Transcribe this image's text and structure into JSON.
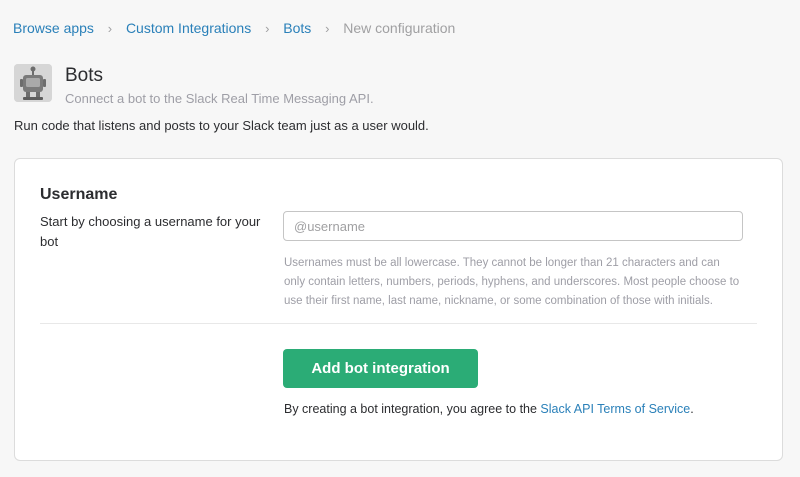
{
  "breadcrumb": {
    "items": [
      "Browse apps",
      "Custom Integrations",
      "Bots"
    ],
    "current": "New configuration",
    "separator": ">"
  },
  "app": {
    "icon": "robot-icon",
    "title": "Bots",
    "subtitle": "Connect a bot to the Slack Real Time Messaging API.",
    "description": "Run code that listens and posts to your Slack team just as a user would."
  },
  "form": {
    "username_title": "Username",
    "username_help": "Start by choosing a username for your bot",
    "username_value": "",
    "username_placeholder": "@username",
    "username_note": "Usernames must be all lowercase. They cannot be longer than 21 characters and can only contain letters, numbers, periods, hyphens, and underscores. Most people choose to use their first name, last name, nickname, or some combination of those with initials.",
    "submit_label": "Add bot integration",
    "terms_prefix": "By creating a bot integration, you agree to the ",
    "terms_link": "Slack API Terms of Service",
    "terms_suffix": "."
  },
  "colors": {
    "link": "#2a80b9",
    "button": "#2bac76",
    "muted": "#9e9ea6"
  }
}
